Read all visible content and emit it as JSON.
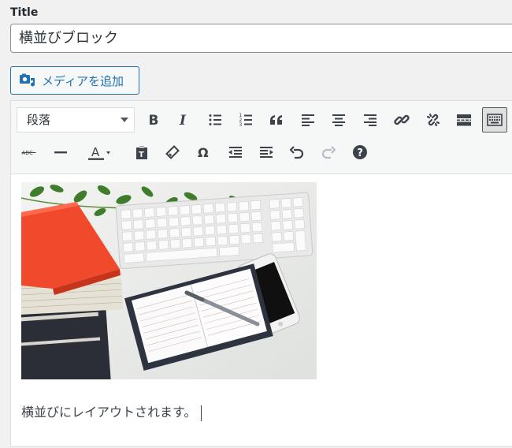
{
  "title_label": "Title",
  "title_value": "横並びブロック",
  "media_button": "メディアを追加",
  "format_select": "段落",
  "paragraph": "横並びにレイアウトされます。",
  "colors": {
    "accent": "#2271b1",
    "book_red": "#f0492b"
  },
  "toolbar": {
    "row1": [
      "bold-icon",
      "italic-icon",
      "bulleted-list-icon",
      "numbered-list-icon",
      "blockquote-icon",
      "align-left-icon",
      "align-center-icon",
      "align-right-icon",
      "insert-link-icon",
      "remove-link-icon",
      "read-more-icon",
      "toolbar-toggle-icon"
    ],
    "row2": [
      "strikethrough-icon",
      "horizontal-line-icon",
      "text-color-icon",
      "paste-as-text-icon",
      "clear-formatting-icon",
      "special-character-icon",
      "decrease-indent-icon",
      "increase-indent-icon",
      "undo-icon",
      "redo-icon",
      "help-icon"
    ]
  }
}
